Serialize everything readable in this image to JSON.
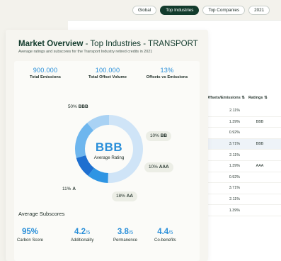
{
  "filters": [
    {
      "label": "Global",
      "active": false
    },
    {
      "label": "Top Industries",
      "active": true
    },
    {
      "label": "Top Companies",
      "active": false
    },
    {
      "label": "2021",
      "active": false
    }
  ],
  "table": {
    "col_offsets": "Offsets/Emissions ⇅",
    "col_ratings": "Ratings ⇅",
    "rows": [
      {
        "offsets": "2.11%",
        "rating": "",
        "highlight": false
      },
      {
        "offsets": "1.39%",
        "rating": "BBB",
        "highlight": false
      },
      {
        "offsets": "0.92%",
        "rating": "",
        "highlight": false
      },
      {
        "offsets": "3.71%",
        "rating": "BBB",
        "highlight": true
      },
      {
        "offsets": "2.11%",
        "rating": "",
        "highlight": false
      },
      {
        "offsets": "1.39%",
        "rating": "AAA",
        "highlight": false
      },
      {
        "offsets": "0.92%",
        "rating": "",
        "highlight": false
      },
      {
        "offsets": "3.71%",
        "rating": "",
        "highlight": false
      },
      {
        "offsets": "2.11%",
        "rating": "",
        "highlight": false
      },
      {
        "offsets": "1.39%",
        "rating": "",
        "highlight": false
      }
    ]
  },
  "overview": {
    "title_bold": "Market Overview",
    "title_rest": " - Top Industries - TRANSPORT",
    "subtitle": "Average ratings and subscores for the Transport Industry retired credits in 2021",
    "stats": [
      {
        "value": "900.000",
        "label": "Total Emissions"
      },
      {
        "value": "100.000",
        "label": "Total Offset Volume"
      },
      {
        "value": "13%",
        "label": "Offsets  vs Emissions"
      }
    ],
    "average_rating": {
      "grade": "BBB",
      "label": "Average Rating"
    },
    "distribution": [
      {
        "pct": "50%",
        "grade": "BBB",
        "share": 50,
        "color": "#cfe4f7"
      },
      {
        "pct": "10%",
        "grade": "BB",
        "share": 10,
        "color": "#2f95e3"
      },
      {
        "pct": "10%",
        "grade": "AAA",
        "share": 10,
        "color": "#1e6fd0"
      },
      {
        "pct": "18%",
        "grade": "AA",
        "share": 18,
        "color": "#6eb6ee"
      },
      {
        "pct": "11%",
        "grade": "A",
        "share": 11,
        "color": "#a9d2f4"
      }
    ],
    "subscores_title": "Average Subscores",
    "subscores": [
      {
        "value": "95%",
        "suffix": "",
        "label": "Carbon Score"
      },
      {
        "value": "4.2",
        "suffix": "/5",
        "label": "Additionality"
      },
      {
        "value": "3.8",
        "suffix": "/5",
        "label": "Permanence"
      },
      {
        "value": "4.4",
        "suffix": "/5",
        "label": "Co-benefits"
      }
    ]
  }
}
